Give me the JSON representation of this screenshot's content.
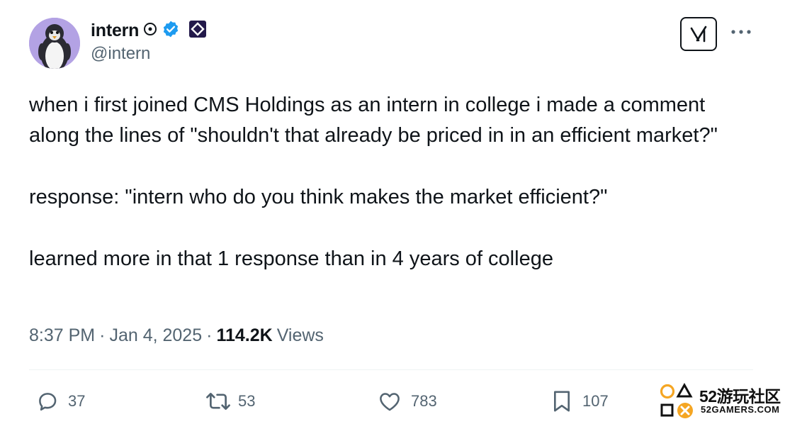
{
  "author": {
    "display_name": "intern",
    "handle": "@intern",
    "avatar_icon": "penguin-avatar",
    "verified": true,
    "verified_color": "#1d9bf0"
  },
  "tweet": {
    "paragraphs": [
      "when i first joined CMS Holdings as an intern in college i made a comment along the lines of \"shouldn't that already be priced in in an efficient market?\"",
      "response: \"intern who do you think makes the market efficient?\"",
      "learned more in that 1 response than in 4 years of college"
    ],
    "time": "8:37 PM",
    "separator": "·",
    "date": "Jan 4, 2025",
    "views_count": "114.2K",
    "views_label": "Views"
  },
  "actions": {
    "reply_count": "37",
    "retweet_count": "53",
    "like_count": "783",
    "bookmark_count": "107"
  },
  "watermark": {
    "line1": "52游玩社区",
    "line2": "52GAMERS.COM"
  },
  "colors": {
    "text": "#0f1419",
    "secondary": "#536471",
    "accent": "#1d9bf0",
    "watermark_orange": "#f5a623"
  }
}
